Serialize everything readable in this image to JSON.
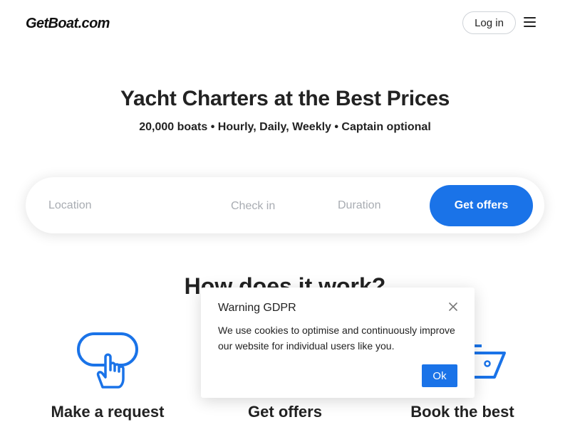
{
  "header": {
    "logo": "GetBoat.com",
    "login_label": "Log in",
    "menu_icon": "hamburger-menu-icon"
  },
  "hero": {
    "title": "Yacht Charters at the Best Prices",
    "subtitle": "20,000 boats • Hourly, Daily, Weekly • Captain optional"
  },
  "search": {
    "location_placeholder": "Location",
    "checkin_placeholder": "Check in",
    "duration_placeholder": "Duration",
    "submit_label": "Get offers"
  },
  "how": {
    "title": "How does it work?",
    "steps": [
      {
        "label": "Make a request",
        "icon": "hand-tap-icon"
      },
      {
        "label": "Get offers",
        "icon": "offers-icon"
      },
      {
        "label": "Book the best",
        "icon": "boat-icon"
      }
    ]
  },
  "gdpr": {
    "title": "Warning GDPR",
    "text": "We use cookies to optimise and continuously improve our website for individual users like you.",
    "ok_label": "Ok",
    "close_icon": "close-icon"
  },
  "colors": {
    "accent": "#1a73e8",
    "text": "#222222",
    "placeholder": "#a8acb2"
  }
}
